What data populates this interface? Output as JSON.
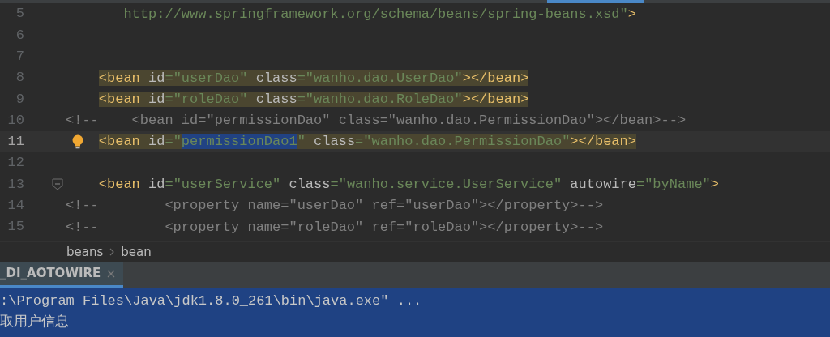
{
  "editor": {
    "lines": [
      {
        "number": "5",
        "highlighted": false,
        "current": false,
        "tokens": [
          {
            "text": "       http://www.springframework.org/schema/beans/spring-beans.xsd\"",
            "kind": "value"
          },
          {
            "text": ">",
            "kind": "tag"
          }
        ]
      },
      {
        "number": "6",
        "highlighted": false,
        "current": false
      },
      {
        "number": "7",
        "highlighted": false,
        "current": false
      },
      {
        "number": "8",
        "highlighted": true,
        "current": false,
        "tokens": [
          {
            "text": "    <bean ",
            "kind": "tag"
          },
          {
            "text": "id",
            "kind": "attr"
          },
          {
            "text": "=\"userDao\" ",
            "kind": "value"
          },
          {
            "text": "class",
            "kind": "attr"
          },
          {
            "text": "=\"wanho.dao.UserDao\"",
            "kind": "value"
          },
          {
            "text": "></bean>",
            "kind": "tag"
          }
        ]
      },
      {
        "number": "9",
        "highlighted": true,
        "current": false,
        "tokens": [
          {
            "text": "    <bean ",
            "kind": "tag"
          },
          {
            "text": "id",
            "kind": "attr"
          },
          {
            "text": "=\"roleDao\" ",
            "kind": "value"
          },
          {
            "text": "class",
            "kind": "attr"
          },
          {
            "text": "=\"wanho.dao.RoleDao\"",
            "kind": "value"
          },
          {
            "text": "></bean>",
            "kind": "tag"
          }
        ]
      },
      {
        "number": "10",
        "highlighted": false,
        "current": false,
        "tokens": [
          {
            "text": "<!--    <bean id=\"permissionDao\" class=\"wanho.dao.PermissionDao\"></bean>-->",
            "kind": "comment"
          }
        ]
      },
      {
        "number": "11",
        "highlighted": true,
        "current": true,
        "intention_bulb": true,
        "tokens": [
          {
            "text": "    <bean ",
            "kind": "tag"
          },
          {
            "text": "id",
            "kind": "attr"
          },
          {
            "text": "=\"",
            "kind": "value"
          },
          {
            "text": "permissionDao1",
            "kind": "value",
            "selected": true
          },
          {
            "text": "\" ",
            "kind": "value"
          },
          {
            "text": "class",
            "kind": "attr"
          },
          {
            "text": "=\"wanho.dao.PermissionDao\"",
            "kind": "value"
          },
          {
            "text": "></bean>",
            "kind": "tag"
          }
        ]
      },
      {
        "number": "12",
        "highlighted": false,
        "current": false
      },
      {
        "number": "13",
        "highlighted": false,
        "current": false,
        "foldable": true,
        "tokens": [
          {
            "text": "    <bean ",
            "kind": "tag"
          },
          {
            "text": "id",
            "kind": "attr"
          },
          {
            "text": "=\"userService\" ",
            "kind": "value"
          },
          {
            "text": "class",
            "kind": "attr"
          },
          {
            "text": "=\"wanho.service.UserService\" ",
            "kind": "value"
          },
          {
            "text": "autowire",
            "kind": "attr"
          },
          {
            "text": "=\"byName\"",
            "kind": "value"
          },
          {
            "text": ">",
            "kind": "tag"
          }
        ]
      },
      {
        "number": "14",
        "highlighted": false,
        "current": false,
        "tokens": [
          {
            "text": "<!--        <property name=\"userDao\" ref=\"userDao\"></property>-->",
            "kind": "comment"
          }
        ]
      },
      {
        "number": "15",
        "highlighted": false,
        "current": false,
        "tokens": [
          {
            "text": "<!--        <property name=\"roleDao\" ref=\"roleDao\"></property>-->",
            "kind": "comment"
          }
        ]
      }
    ]
  },
  "breadcrumbs": [
    "beans",
    "bean"
  ],
  "run_tab": {
    "label": "_DI_AOTOWIRE",
    "selected": true
  },
  "console": {
    "lines": [
      ":\\Program Files\\Java\\jdk1.8.0_261\\bin\\java.exe\" ...",
      "取用户信息"
    ]
  }
}
